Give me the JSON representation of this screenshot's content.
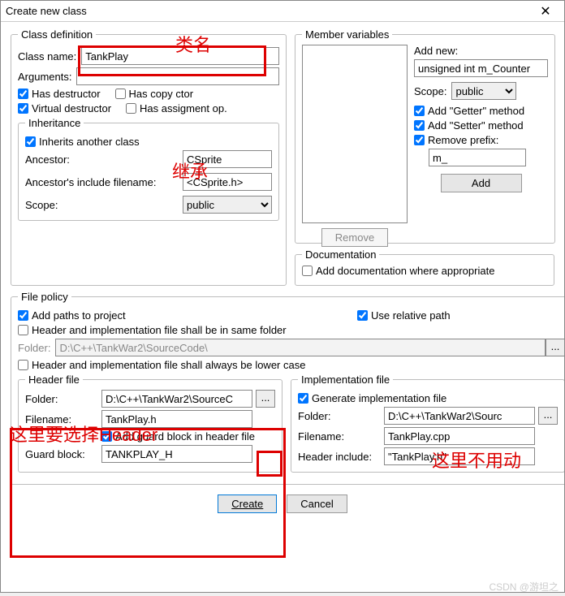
{
  "window": {
    "title": "Create new class"
  },
  "classdef": {
    "legend": "Class definition",
    "classname_lbl": "Class name:",
    "classname_val": "TankPlay",
    "arguments_lbl": "Arguments:",
    "arguments_val": "",
    "has_destructor": "Has destructor",
    "has_copy_ctor": "Has copy ctor",
    "virtual_destructor": "Virtual destructor",
    "has_assign": "Has assigment op.",
    "inheritance": {
      "legend": "Inheritance",
      "inherits": "Inherits another class",
      "ancestor_lbl": "Ancestor:",
      "ancestor_val": "CSprite",
      "incfile_lbl": "Ancestor's include filename:",
      "incfile_val": "<CSprite.h>",
      "scope_lbl": "Scope:",
      "scope_val": "public"
    }
  },
  "membervars": {
    "legend": "Member variables",
    "addnew_lbl": "Add new:",
    "addnew_val": "unsigned int m_Counter",
    "scope_lbl": "Scope:",
    "scope_val": "public",
    "getter": "Add \"Getter\" method",
    "setter": "Add \"Setter\" method",
    "remove_prefix_lbl": "Remove prefix:",
    "remove_prefix_val": "m_",
    "add_btn": "Add",
    "remove_btn": "Remove"
  },
  "doc": {
    "legend": "Documentation",
    "add_doc": "Add documentation where appropriate"
  },
  "filepolicy": {
    "legend": "File policy",
    "add_paths": "Add paths to project",
    "use_rel": "Use relative path",
    "same_folder": "Header and implementation file shall be in same folder",
    "folder_lbl": "Folder:",
    "folder_val": "D:\\C++\\TankWar2\\SourceCode\\",
    "lower_case": "Header and implementation file shall always be lower case",
    "header": {
      "legend": "Header file",
      "folder_lbl": "Folder:",
      "folder_val": "D:\\C++\\TankWar2\\SourceC",
      "filename_lbl": "Filename:",
      "filename_val": "TankPlay.h",
      "guard_cb": "Add guard block in header file",
      "guard_lbl": "Guard block:",
      "guard_val": "TANKPLAY_H"
    },
    "impl": {
      "legend": "Implementation file",
      "gen": "Generate implementation file",
      "folder_lbl": "Folder:",
      "folder_val": "D:\\C++\\TankWar2\\Sourc",
      "filename_lbl": "Filename:",
      "filename_val": "TankPlay.cpp",
      "hinc_lbl": "Header include:",
      "hinc_val": "\"TankPlay.h\""
    }
  },
  "buttons": {
    "create": "Create",
    "cancel": "Cancel"
  },
  "annotations": {
    "a1": "类名",
    "a2": "继承",
    "a3": "这里要选择Header",
    "a4": "这里不用动"
  },
  "watermark": "CSDN @游坦之"
}
